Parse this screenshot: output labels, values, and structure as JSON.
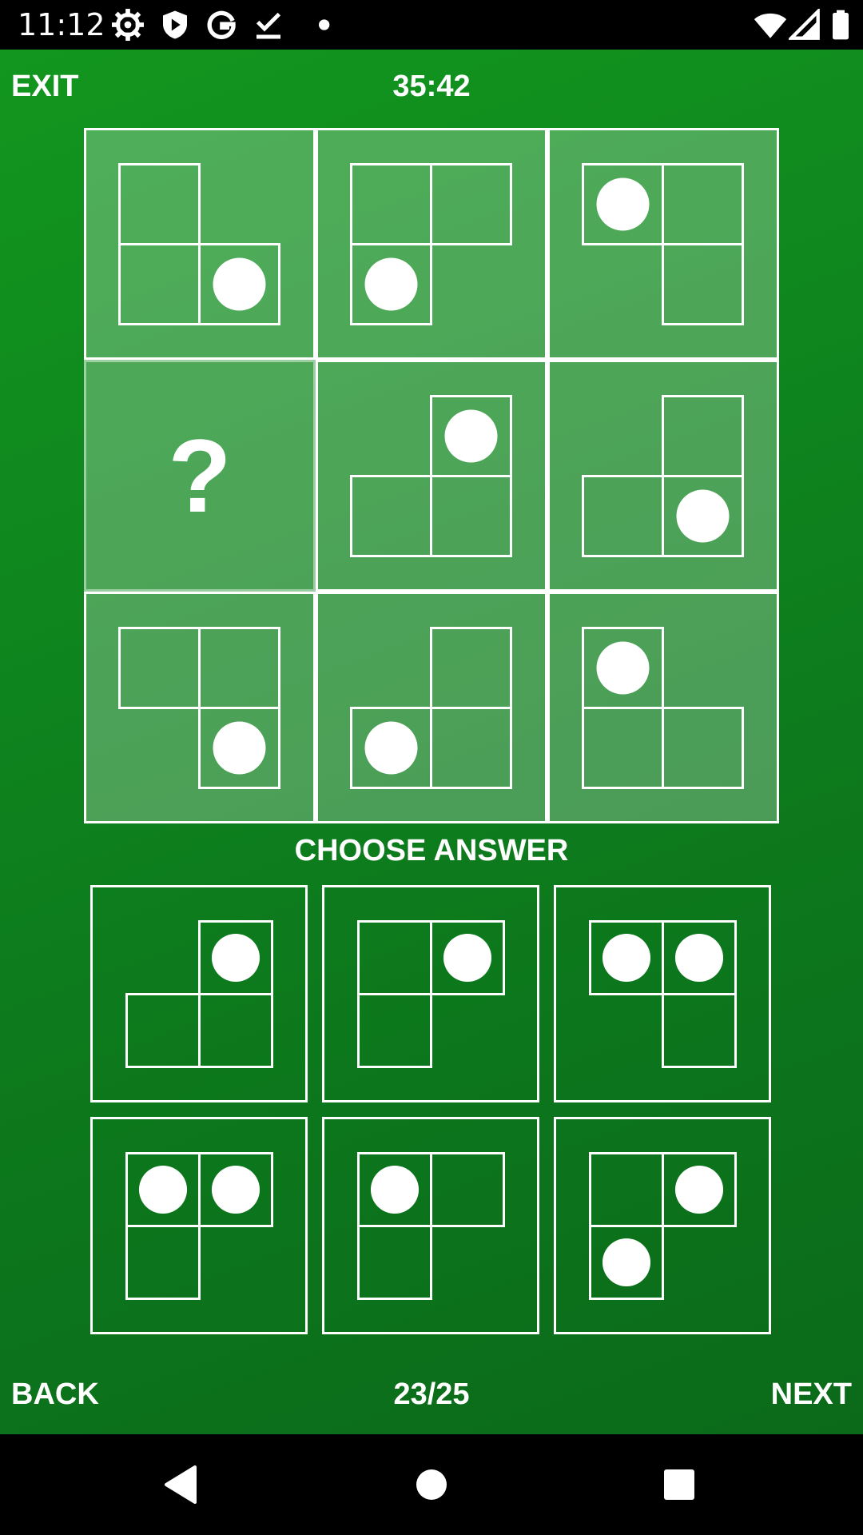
{
  "status_bar": {
    "time": "11:12",
    "icons": [
      "gear-icon",
      "shield-play-icon",
      "google-icon",
      "download-done-icon",
      "dot-icon",
      "wifi-icon",
      "signal-icon",
      "battery-icon"
    ]
  },
  "topbar": {
    "exit_label": "EXIT",
    "timer": "35:42"
  },
  "puzzle": {
    "missing_symbol": "?",
    "cells": [
      {
        "blank": 1,
        "dot": 3
      },
      {
        "blank": 3,
        "dot": 2
      },
      {
        "blank": 2,
        "dot": 0
      },
      {
        "missing": true
      },
      {
        "blank": 0,
        "dot": 1
      },
      {
        "blank": 0,
        "dot": 3
      },
      {
        "blank": 2,
        "dot": 3
      },
      {
        "blank": 0,
        "dot": 2
      },
      {
        "blank": 1,
        "dot": 0
      }
    ]
  },
  "choose_label": "CHOOSE ANSWER",
  "answers": [
    {
      "blank": 0,
      "dots": [
        1
      ]
    },
    {
      "blank": 3,
      "dots": [
        1
      ]
    },
    {
      "blank": 2,
      "dots": [
        0,
        1
      ]
    },
    {
      "blank": 3,
      "dots": [
        0,
        1
      ]
    },
    {
      "blank": 3,
      "dots": [
        0
      ]
    },
    {
      "blank": 3,
      "dots": [
        1,
        2
      ]
    }
  ],
  "footer": {
    "back_label": "BACK",
    "progress": "23/25",
    "next_label": "NEXT"
  },
  "navbar": {
    "icons": [
      "back-triangle-icon",
      "home-circle-icon",
      "recents-square-icon"
    ]
  },
  "colors": {
    "background_top": "#12961f",
    "background_bottom": "#0b6a1a",
    "line": "#ffffff"
  }
}
